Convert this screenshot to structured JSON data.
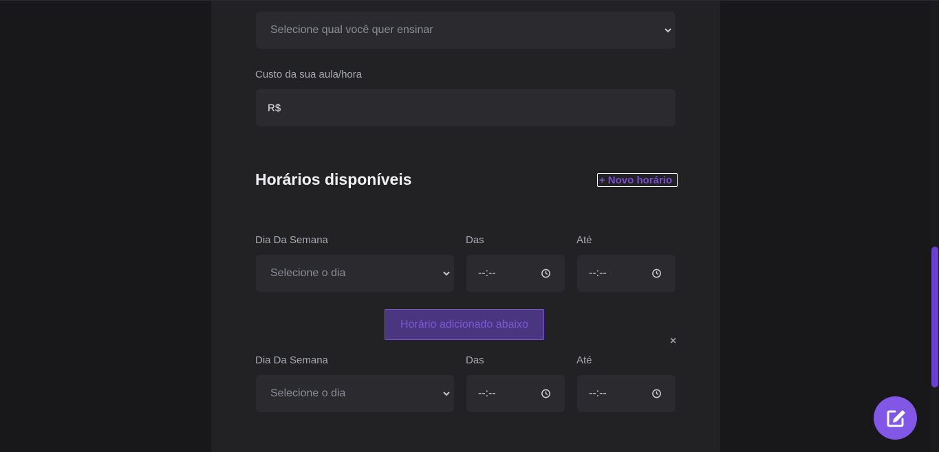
{
  "subject": {
    "placeholder": "Selecione qual você quer ensinar"
  },
  "cost": {
    "label": "Custo da sua aula/hora",
    "value": "R$"
  },
  "schedule": {
    "title": "Horários disponíveis",
    "new_button": "+ Novo horário",
    "added_button": "Horário adicionado abaixo",
    "close_glyph": "×",
    "rows": [
      {
        "day_label": "Dia Da Semana",
        "day_placeholder": "Selecione o dia",
        "from_label": "Das",
        "from_value": "--:--",
        "to_label": "Até",
        "to_value": "--:--"
      },
      {
        "day_label": "Dia Da Semana",
        "day_placeholder": "Selecione o dia",
        "from_label": "Das",
        "from_value": "--:--",
        "to_label": "Até",
        "to_value": "--:--"
      }
    ]
  },
  "icons": {
    "chevron": "chevron-down-icon",
    "clock": "clock-icon",
    "close": "close-icon",
    "fab": "edit-icon"
  },
  "colors": {
    "accent": "#8257e5",
    "background": "#18181b",
    "card": "#222225",
    "field": "#2b2b2f"
  }
}
